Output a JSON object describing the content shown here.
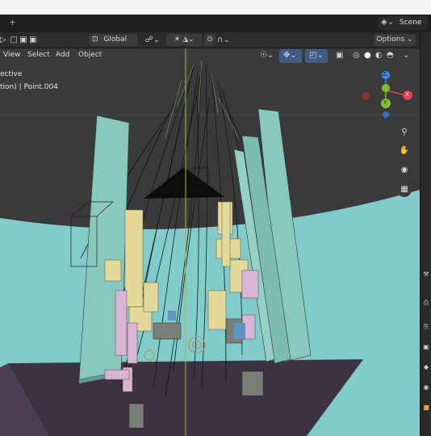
{
  "workspace": {
    "add_tab_label": "+",
    "scene_label": "Scene"
  },
  "header": {
    "orientation_label": "Global",
    "options_label": "Options"
  },
  "viewport_menu": {
    "items": [
      "View",
      "Select",
      "Add",
      "Object"
    ]
  },
  "overlay": {
    "line1": "ective",
    "line2": "tion) | Point.004"
  },
  "gizmo": {
    "z_label": "Z",
    "x_label": "X",
    "y_label": "Y"
  },
  "colors": {
    "background": "#3a3a3a",
    "floor": "#82cbcb",
    "walls": "#89c9bd",
    "x_axis": "#e0404e",
    "y_axis": "#7ec033",
    "z_axis": "#3d86d8"
  },
  "icons": {
    "scene": "scene-icon",
    "orientation": "transform-orientation-icon",
    "pivot": "pivot-icon",
    "snap": "snap-icon",
    "proportional": "proportional-edit-icon",
    "zoom": "zoom-icon",
    "pan": "hand-icon",
    "camera": "camera-icon",
    "grid": "grid-icon"
  }
}
